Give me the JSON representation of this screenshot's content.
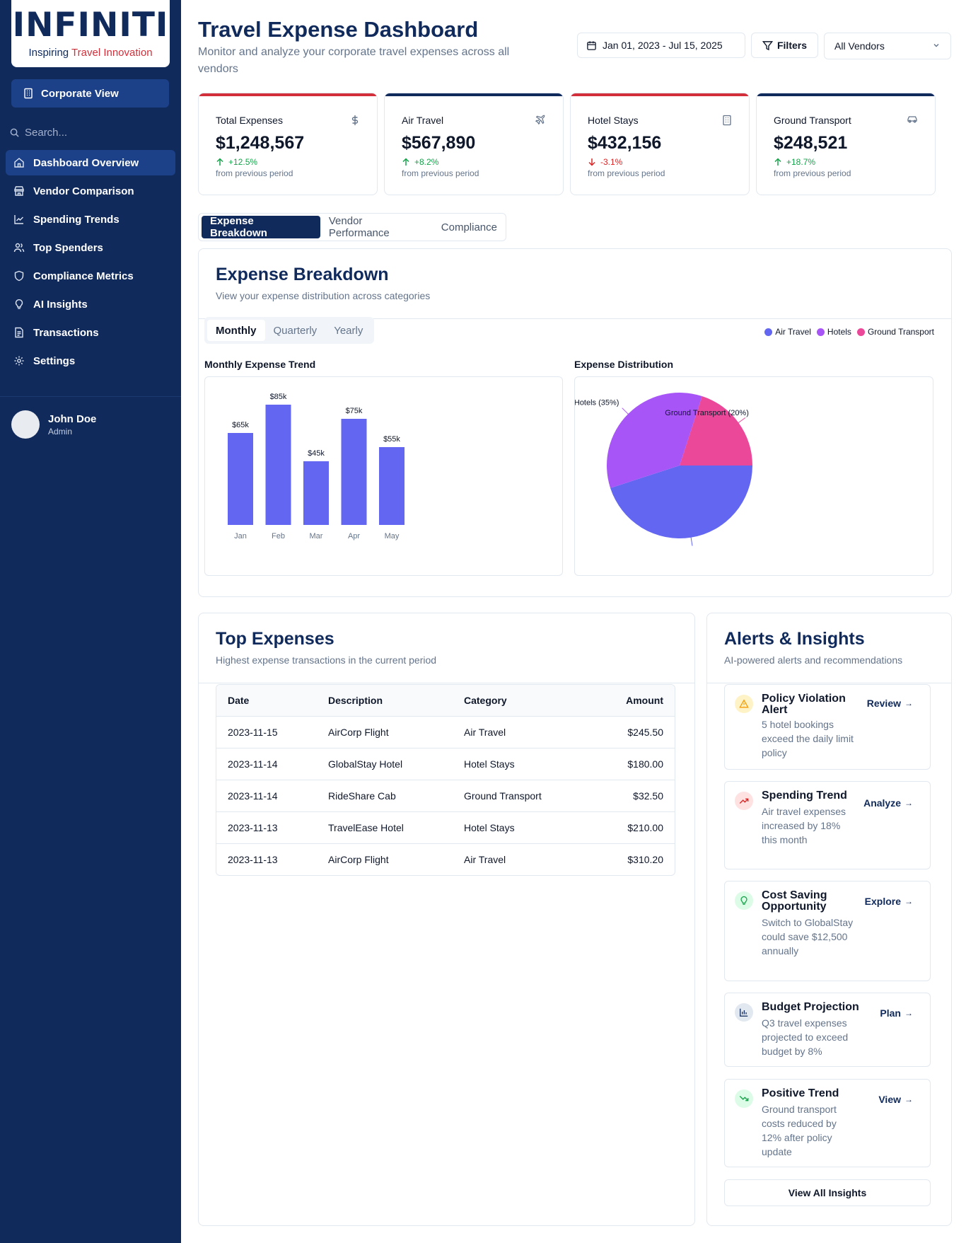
{
  "brand": {
    "name": "INFINITI",
    "tagline_prefix": "Inspiring ",
    "tagline_highlight": "Travel Innovation"
  },
  "sidebar": {
    "corporate_view": "Corporate View",
    "search_placeholder": "Search...",
    "items": [
      {
        "label": "Dashboard Overview",
        "icon": "home-icon"
      },
      {
        "label": "Vendor Comparison",
        "icon": "store-icon"
      },
      {
        "label": "Spending Trends",
        "icon": "line-chart-icon"
      },
      {
        "label": "Top Spenders",
        "icon": "users-icon"
      },
      {
        "label": "Compliance Metrics",
        "icon": "shield-icon"
      },
      {
        "label": "AI Insights",
        "icon": "lightbulb-icon"
      },
      {
        "label": "Transactions",
        "icon": "receipt-icon"
      },
      {
        "label": "Settings",
        "icon": "gear-icon"
      }
    ],
    "user": {
      "name": "John Doe",
      "role": "Admin"
    }
  },
  "header": {
    "title": "Travel Expense Dashboard",
    "subtitle": "Monitor and analyze your corporate travel expenses across all vendors",
    "date_range": "Jan 01, 2023 - Jul 15, 2025",
    "filters_label": "Filters",
    "vendor_select": "All Vendors"
  },
  "kpis": [
    {
      "label": "Total Expenses",
      "value": "$1,248,567",
      "change": "+12.5%",
      "direction": "up",
      "footer": "from previous period",
      "icon": "dollar-icon",
      "accent": "#d32f3a"
    },
    {
      "label": "Air Travel",
      "value": "$567,890",
      "change": "+8.2%",
      "direction": "up",
      "footer": "from previous period",
      "icon": "plane-icon",
      "accent": "#102a5c"
    },
    {
      "label": "Hotel Stays",
      "value": "$432,156",
      "change": "-3.1%",
      "direction": "down",
      "footer": "from previous period",
      "icon": "building-icon",
      "accent": "#d32f3a"
    },
    {
      "label": "Ground Transport",
      "value": "$248,521",
      "change": "+18.7%",
      "direction": "up",
      "footer": "from previous period",
      "icon": "car-icon",
      "accent": "#102a5c"
    }
  ],
  "tabs": [
    "Expense Breakdown",
    "Vendor Performance",
    "Compliance"
  ],
  "breakdown": {
    "title": "Expense Breakdown",
    "subtitle": "View your expense distribution across categories",
    "periods": [
      "Monthly",
      "Quarterly",
      "Yearly"
    ],
    "legend": [
      {
        "label": "Air Travel",
        "color": "#6366f1"
      },
      {
        "label": "Hotels",
        "color": "#a855f7"
      },
      {
        "label": "Ground Transport",
        "color": "#ec4899"
      }
    ],
    "bar_title": "Monthly Expense Trend",
    "pie_title": "Expense Distribution"
  },
  "chart_data": [
    {
      "type": "bar",
      "title": "Monthly Expense Trend",
      "categories": [
        "Jan",
        "Feb",
        "Mar",
        "Apr",
        "May"
      ],
      "values": [
        65,
        85,
        45,
        75,
        55
      ],
      "data_labels": [
        "$65k",
        "$85k",
        "$45k",
        "$75k",
        "$55k"
      ],
      "color": "#6366f1",
      "ylim": [
        0,
        90
      ],
      "grid": false
    },
    {
      "type": "pie",
      "title": "Expense Distribution",
      "slices": [
        {
          "name": "Air Travel",
          "value": 45,
          "color": "#6366f1",
          "label": ""
        },
        {
          "name": "Hotels",
          "value": 35,
          "color": "#a855f7",
          "label": "Hotels (35%)"
        },
        {
          "name": "Ground Transport",
          "value": 20,
          "color": "#ec4899",
          "label": "Ground Transport (20%)"
        }
      ]
    }
  ],
  "top_expenses": {
    "title": "Top Expenses",
    "subtitle": "Highest expense transactions in the current period",
    "columns": [
      "Date",
      "Description",
      "Category",
      "Amount"
    ],
    "rows": [
      [
        "2023-11-15",
        "AirCorp Flight",
        "Air Travel",
        "$245.50"
      ],
      [
        "2023-11-14",
        "GlobalStay Hotel",
        "Hotel Stays",
        "$180.00"
      ],
      [
        "2023-11-14",
        "RideShare Cab",
        "Ground Transport",
        "$32.50"
      ],
      [
        "2023-11-13",
        "TravelEase Hotel",
        "Hotel Stays",
        "$210.00"
      ],
      [
        "2023-11-13",
        "AirCorp Flight",
        "Air Travel",
        "$310.20"
      ]
    ]
  },
  "alerts": {
    "title": "Alerts & Insights",
    "subtitle": "AI-powered alerts and recommendations",
    "items": [
      {
        "title": "Policy Violation Alert",
        "desc": "5 hotel bookings exceed the daily limit policy",
        "action": "Review",
        "icon": "warning-icon",
        "color": "#f59e0b",
        "bg": "#fef3c7"
      },
      {
        "title": "Spending Trend",
        "desc": "Air travel expenses increased by 18% this month",
        "action": "Analyze",
        "icon": "trending-up-icon",
        "color": "#dc2626",
        "bg": "#fee2e2"
      },
      {
        "title": "Cost Saving Opportunity",
        "desc": "Switch to GlobalStay could save $12,500 annually",
        "action": "Explore",
        "icon": "lightbulb-icon",
        "color": "#16a34a",
        "bg": "#dcfce7"
      },
      {
        "title": "Budget Projection",
        "desc": "Q3 travel expenses projected to exceed budget by 8%",
        "action": "Plan",
        "icon": "bar-chart-icon",
        "color": "#102a5c",
        "bg": "#e2e8f0"
      },
      {
        "title": "Positive Trend",
        "desc": "Ground transport costs reduced by 12% after policy update",
        "action": "View",
        "icon": "trending-down-icon",
        "color": "#16a34a",
        "bg": "#dcfce7"
      }
    ],
    "view_all": "View All Insights"
  }
}
